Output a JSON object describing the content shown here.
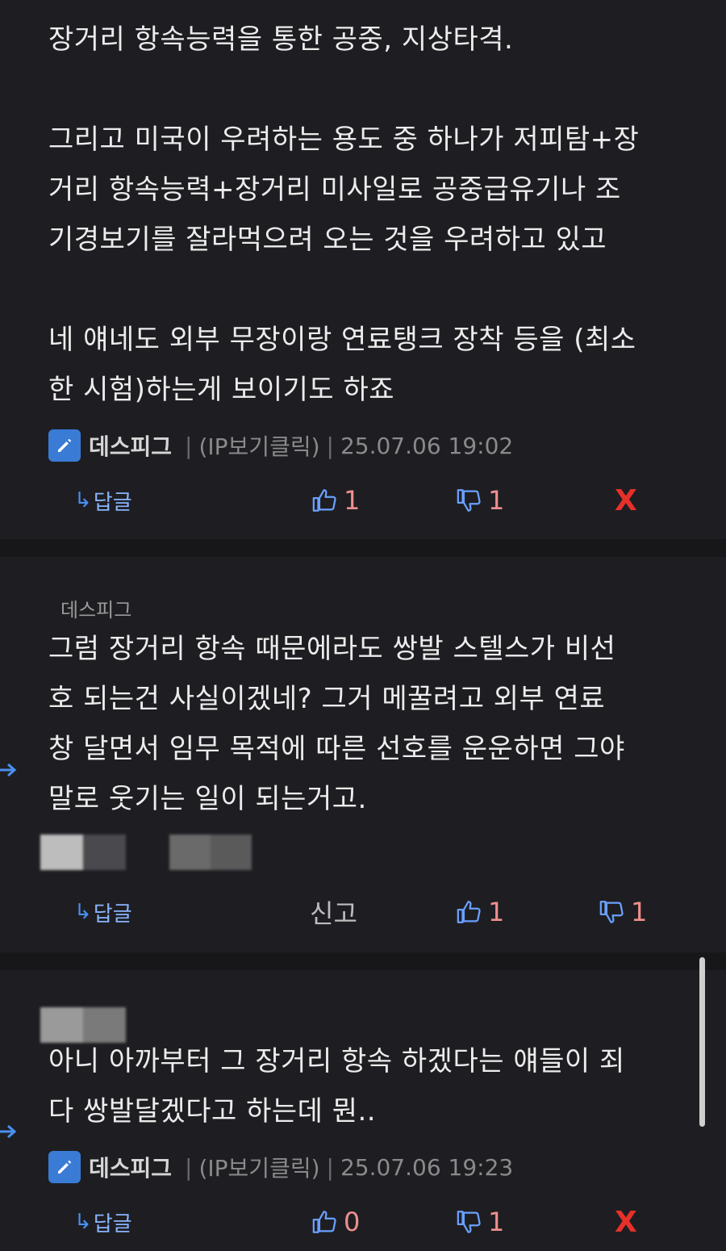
{
  "comment1": {
    "lines_p1": [
      "장거리 항속능력을 통한 공중, 지상타격."
    ],
    "lines_p2": [
      "그리고 미국이 우려하는 용도 중 하나가 저피탐+장",
      "거리 항속능력+장거리 미사일로 공중급유기나 조",
      "기경보기를 잘라먹으려 오는 것을 우려하고 있고"
    ],
    "lines_p3": [
      "네 얘네도 외부 무장이랑 연료탱크 장착 등을 (최소",
      "한 시험)하는게 보이기도 하죠"
    ],
    "author": "데스피그",
    "ip": "(IP보기클릭)",
    "date": "25.07.06 19:02",
    "reply_label": "답글",
    "likes": "1",
    "dislikes": "1",
    "delete_label": "X"
  },
  "comment2": {
    "mention": "데스피그",
    "lines": [
      "그럼 장거리 항속 때문에라도 쌍발 스텔스가 비선",
      "호 되는건 사실이겠네?   그거 메꿀려고 외부 연료",
      "창 달면서 임무 목적에 따른 선호를 운운하면 그야",
      "말로 웃기는 일이 되는거고."
    ],
    "reply_label": "답글",
    "report_label": "신고",
    "likes": "1",
    "dislikes": "1"
  },
  "comment3": {
    "lines": [
      "아니 아까부터 그 장거리 항속 하겠다는 얘들이 죄",
      "다 쌍발달겠다고 하는데 뭔.."
    ],
    "author": "데스피그",
    "ip": "(IP보기클릭)",
    "date": "25.07.06 19:23",
    "reply_label": "답글",
    "likes": "0",
    "dislikes": "1",
    "delete_label": "X"
  },
  "colors": {
    "background": "#1e1e22",
    "accent_blue": "#3a7bd5",
    "count_red": "#ef8f8f",
    "delete_red": "#e8302a"
  },
  "icons": [
    "pencil-icon",
    "reply-arrow-icon",
    "thumbs-up-icon",
    "thumbs-down-icon",
    "left-arrow-icon"
  ]
}
